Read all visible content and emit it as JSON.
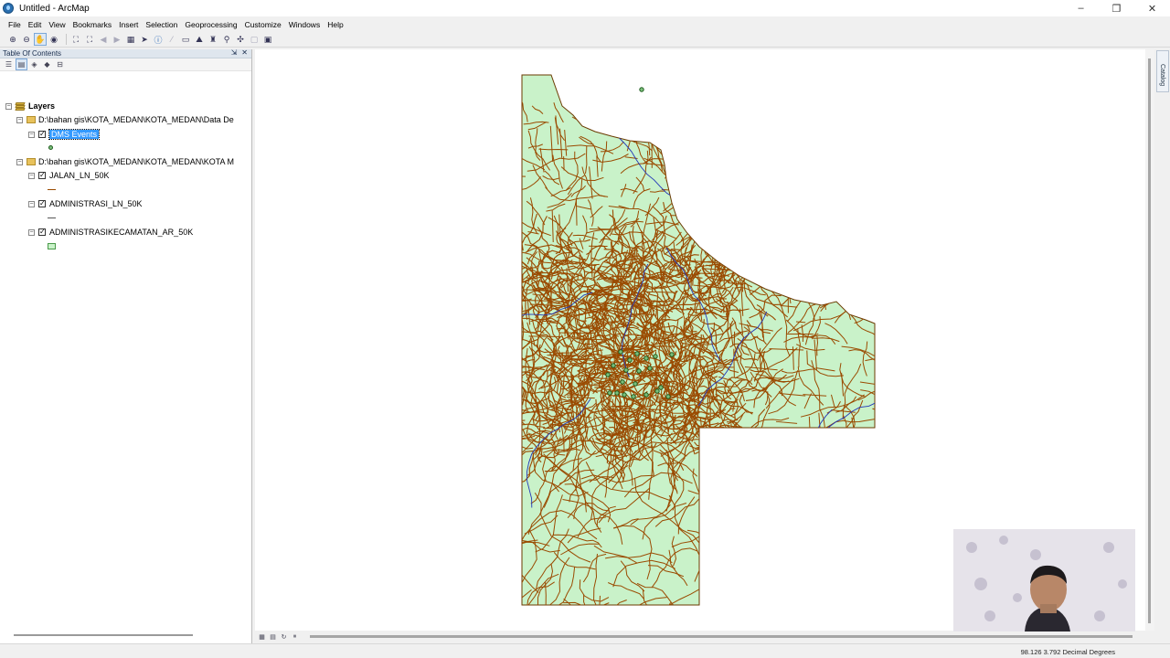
{
  "window": {
    "title": "Untitled - ArcMap",
    "min_glyph": "–",
    "restore_glyph": "❐",
    "close_glyph": "✕"
  },
  "menu": [
    "File",
    "Edit",
    "View",
    "Bookmarks",
    "Insert",
    "Selection",
    "Geoprocessing",
    "Customize",
    "Windows",
    "Help"
  ],
  "toolbar_icons": [
    "zoom-in-icon",
    "zoom-out-icon",
    "pan-icon",
    "full-extent-icon",
    "fixed-zoom-in-icon",
    "fixed-zoom-out-icon",
    "back-icon",
    "forward-icon",
    "select-features-icon",
    "select-elements-icon",
    "identify-icon",
    "html-popup-icon",
    "measure-icon",
    "find-icon",
    "find-route-icon",
    "go-to-xy-icon",
    "time-slider-icon",
    "create-viewer-icon"
  ],
  "toc": {
    "title": "Table Of Contents",
    "pin_glyph": "⇲",
    "close_glyph": "✕",
    "root_label": "Layers",
    "folder1_path": "D:\\bahan gis\\KOTA_MEDAN\\KOTA_MEDAN\\Data De",
    "layer_events": "DMS Events",
    "folder2_path": "D:\\bahan gis\\KOTA_MEDAN\\KOTA_MEDAN\\KOTA M",
    "layer_jalan": "JALAN_LN_50K",
    "layer_admin_ln": "ADMINISTRASI_LN_50K",
    "layer_kecamatan": "ADMINISTRASIKECAMATAN_AR_50K"
  },
  "catalog_tab_label": "Catalog",
  "status": {
    "coords": "98.126  3.792 Decimal Degrees"
  },
  "colors": {
    "map_fill": "#c9f2c9",
    "roads": "#9a4a00",
    "rivers": "#2236b8",
    "points": "#1f5c1f",
    "selection": "#3399ff"
  }
}
